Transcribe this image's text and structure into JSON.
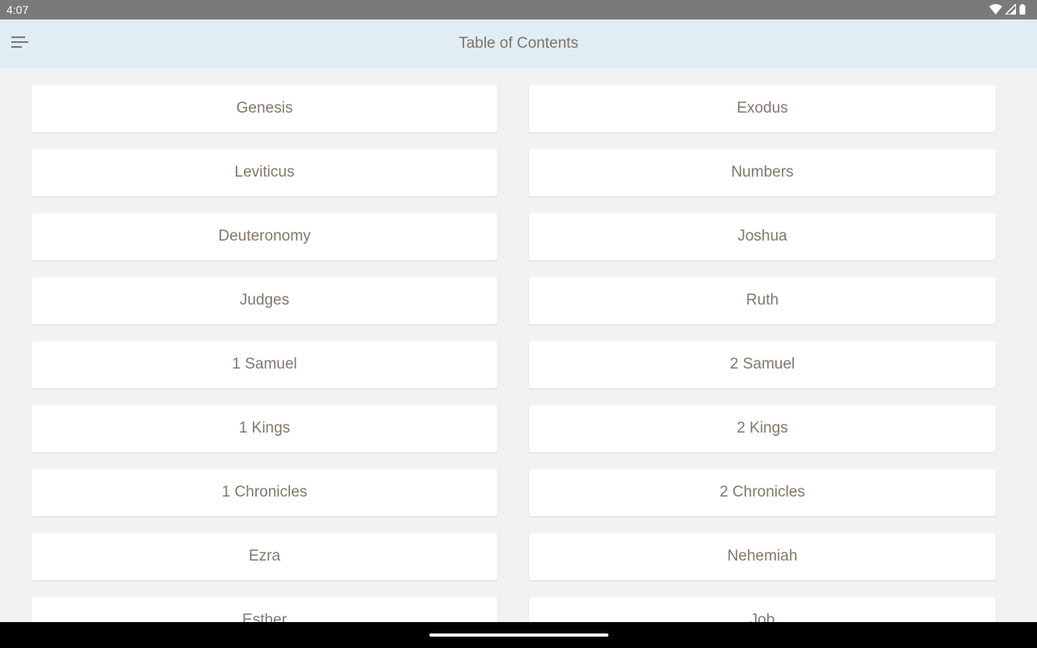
{
  "status_bar": {
    "time": "4:07",
    "icons": [
      "wifi-icon",
      "signal-icon",
      "battery-icon"
    ]
  },
  "app_bar": {
    "menu_icon": "menu-icon",
    "title": "Table of Contents"
  },
  "books": [
    "Genesis",
    "Exodus",
    "Leviticus",
    "Numbers",
    "Deuteronomy",
    "Joshua",
    "Judges",
    "Ruth",
    "1 Samuel",
    "2 Samuel",
    "1 Kings",
    "2 Kings",
    "1 Chronicles",
    "2 Chronicles",
    "Ezra",
    "Nehemiah",
    "Esther",
    "Job"
  ],
  "colors": {
    "status_bar": "#7a7a7a",
    "app_bar": "#e1edf4",
    "background": "#f2f2f2",
    "card": "#ffffff",
    "card_text": "#83776c",
    "title_text": "#7d736b"
  }
}
